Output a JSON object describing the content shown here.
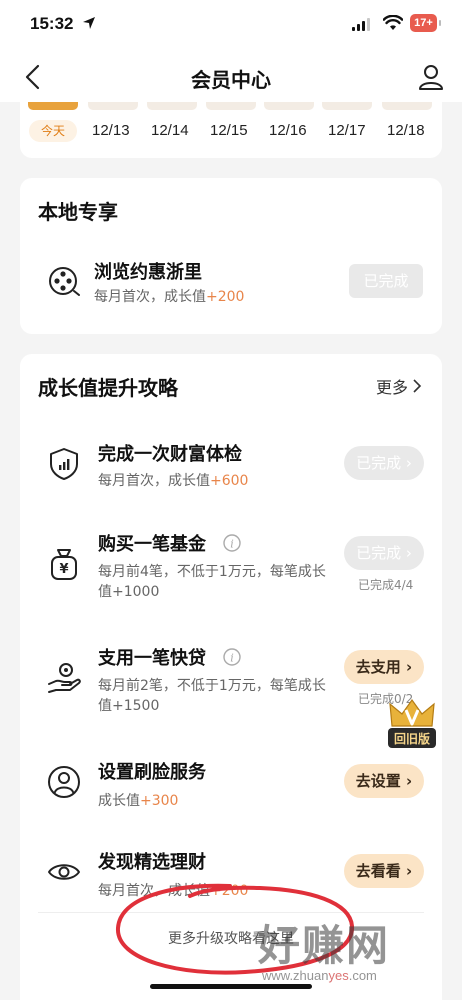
{
  "status_bar": {
    "time": "15:32",
    "battery": "17+"
  },
  "nav": {
    "title": "会员中心"
  },
  "calendar": {
    "today_label": "今天",
    "days": [
      "12/13",
      "12/14",
      "12/15",
      "12/16",
      "12/17",
      "12/18"
    ]
  },
  "local": {
    "title": "本地专享",
    "task": {
      "title": "浏览约惠浙里",
      "sub_prefix": "每月首次，成长值",
      "bonus": "+200",
      "button": "已完成"
    }
  },
  "growth": {
    "title": "成长值提升攻略",
    "more": "更多",
    "tasks": [
      {
        "title": "完成一次财富体检",
        "sub_prefix": "每月首次，成长值",
        "bonus": "+600",
        "button": "已完成",
        "done": true,
        "progress": ""
      },
      {
        "title": "购买一笔基金",
        "sub_line1": "每月前4笔，不低于1万元，每笔成长",
        "sub_line2_prefix": "值",
        "bonus": "+1000",
        "button": "已完成",
        "done": true,
        "progress": "已完成4/4"
      },
      {
        "title": "支用一笔快贷",
        "sub_line1": "每月前2笔，不低于1万元，每笔成长",
        "sub_line2_prefix": "值",
        "bonus": "+1500",
        "button": "去支用",
        "done": false,
        "progress": "已完成0/2"
      },
      {
        "title": "设置刷脸服务",
        "sub_prefix": "成长值",
        "bonus": "+300",
        "button": "去设置",
        "done": false,
        "progress": ""
      },
      {
        "title": "发现精选理财",
        "sub_prefix": "每月首次，成长值",
        "bonus": "+200",
        "button": "去看看",
        "done": false,
        "progress": ""
      }
    ],
    "footer": "更多升级攻略看这里"
  },
  "retro_badge": {
    "label": "回旧版"
  },
  "watermark": {
    "text": "好赚网",
    "url_prefix": "www.zhuan",
    "url_accent": "yes",
    "url_suffix": ".com"
  },
  "colors": {
    "accent_orange": "#e8854a",
    "today_orange": "#e8a23c",
    "go_button_bg": "#fbe4c6",
    "done_button_bg": "#e9e9e9",
    "annotation_red": "#e0303a"
  }
}
